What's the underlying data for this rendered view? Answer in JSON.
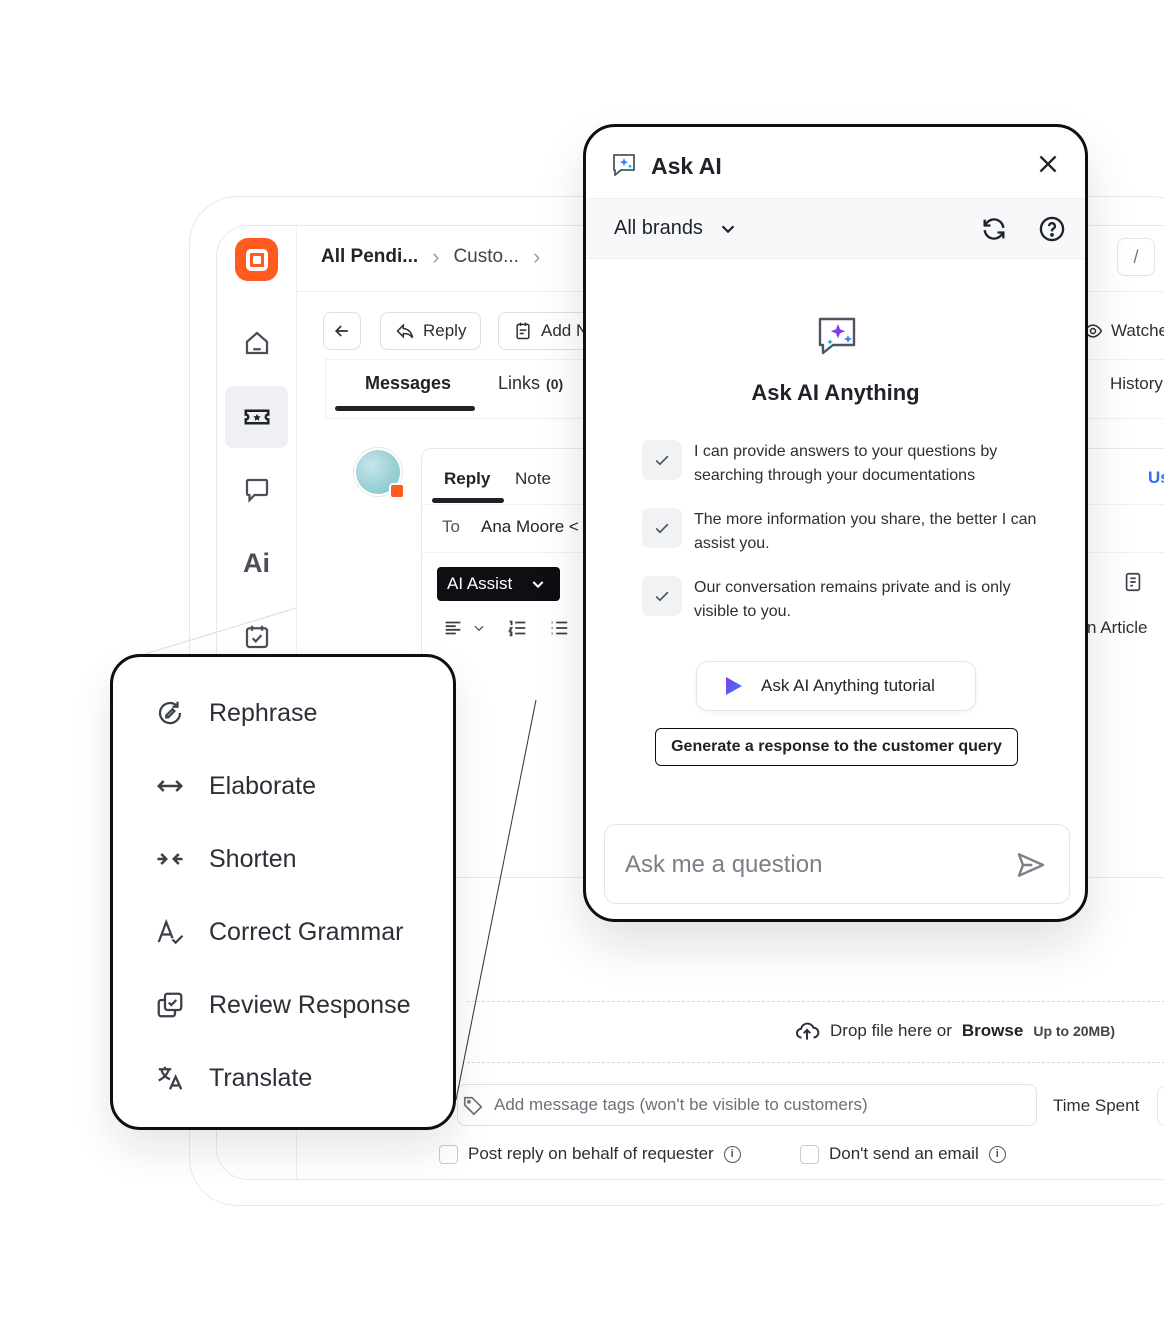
{
  "app": {
    "breadcrumb": [
      "All Pendi...",
      "Custo...",
      "›"
    ],
    "slash_key": "/",
    "toolbar": {
      "reply": "Reply",
      "add": "Add N",
      "watchers": "Watche"
    },
    "tabs": {
      "messages": "Messages",
      "links": "Links",
      "links_count": "(0)",
      "history": "History"
    },
    "editor": {
      "reply_tab": "Reply",
      "note_tab": "Note",
      "to_label": "To",
      "to_name": "Ana Moore <",
      "ai_assist": "AI Assist",
      "side_link": "Us",
      "article": "n Article"
    },
    "drop": {
      "text": "Drop file here or",
      "browse": "Browse",
      "limit": "Up to 20MB)"
    },
    "tags_placeholder": "Add message tags (won't be visible to customers)",
    "time_spent": "Time Spent",
    "checks": {
      "post_on_behalf": "Post reply on behalf of requester",
      "no_email": "Don't send an email"
    },
    "rail_ai_label": "Ai"
  },
  "menu": {
    "items": [
      {
        "label": "Rephrase",
        "icon": "rephrase-icon"
      },
      {
        "label": "Elaborate",
        "icon": "elaborate-icon"
      },
      {
        "label": "Shorten",
        "icon": "shorten-icon"
      },
      {
        "label": "Correct Grammar",
        "icon": "grammar-icon"
      },
      {
        "label": "Review Response",
        "icon": "review-icon"
      },
      {
        "label": "Translate",
        "icon": "translate-icon"
      }
    ]
  },
  "ask_ai": {
    "title": "Ask AI",
    "brands": "All brands",
    "heading": "Ask AI Anything",
    "features": [
      "I can provide answers to your questions by searching through your documentations",
      "The more information you share, the better I can assist you.",
      "Our conversation remains private and is only visible to you."
    ],
    "tutorial": "Ask AI Anything tutorial",
    "generate": "Generate a response to the customer query",
    "input_placeholder": "Ask me a question"
  },
  "colors": {
    "brand": "#ff5a1f",
    "dark": "#0d0f12",
    "accent_blue": "#3b82f6",
    "accent_purple": "#7c3aed"
  }
}
